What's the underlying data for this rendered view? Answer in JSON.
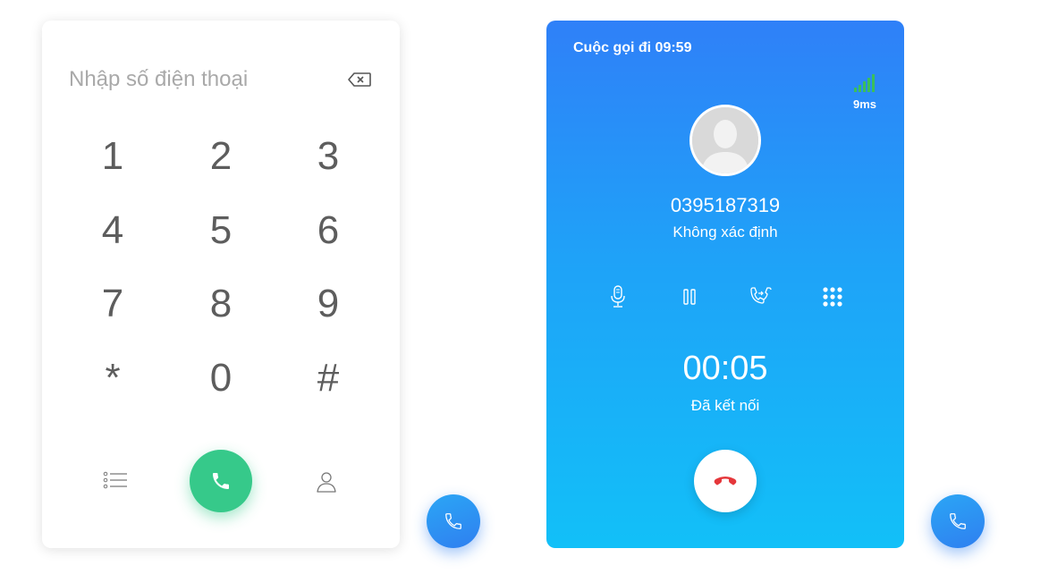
{
  "dialer": {
    "phone_input": {
      "placeholder": "Nhập số điện thoại",
      "value": ""
    },
    "keys": [
      "1",
      "2",
      "3",
      "4",
      "5",
      "6",
      "7",
      "8",
      "9",
      "*",
      "0",
      "#"
    ],
    "icons": {
      "backspace": "backspace-icon",
      "history": "list-icon",
      "call": "phone-icon",
      "contacts": "user-icon"
    },
    "call_button_color": "#36c98a"
  },
  "call": {
    "title": "Cuộc gọi đi 09:59",
    "latency": "9ms",
    "signal_color": "#3bbf5b",
    "number": "0395187319",
    "name": "Không xác định",
    "controls": [
      "microphone-icon",
      "pause-icon",
      "transfer-icon",
      "keypad-grid-icon"
    ],
    "timer": "00:05",
    "status": "Đã kết nối",
    "hangup_icon_color": "#e5373b",
    "gradient": [
      "#2f80f8",
      "#12c0f8"
    ]
  },
  "fab_color": "#2f7ff0"
}
